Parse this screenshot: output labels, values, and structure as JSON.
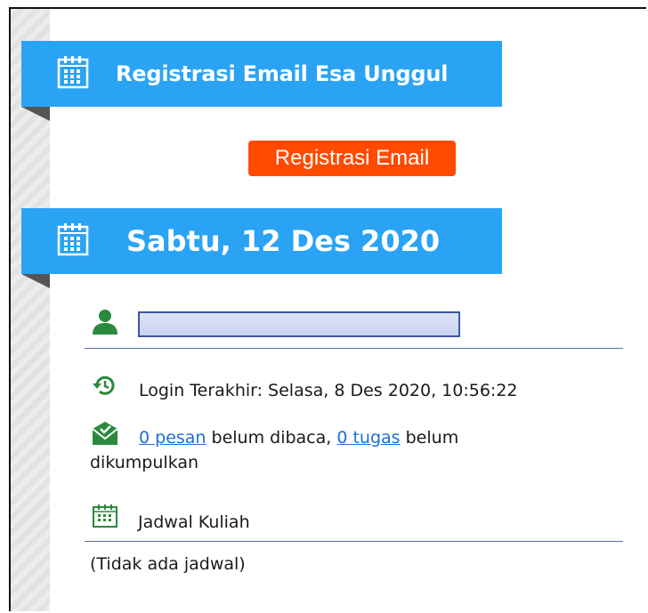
{
  "banner1": {
    "title": "Registrasi Email Esa Unggul",
    "button_label": "Registrasi Email"
  },
  "banner2": {
    "date": "Sabtu, 12 Des 2020"
  },
  "user": {
    "name_value": ""
  },
  "login": {
    "text": "Login Terakhir: Selasa, 8 Des 2020, 10:56:22"
  },
  "messages": {
    "pesan_link": "0 pesan",
    "middle_text": " belum dibaca, ",
    "tugas_link": "0 tugas",
    "tail_text": " belum",
    "line2": "dikumpulkan"
  },
  "schedule": {
    "title": "Jadwal Kuliah",
    "empty": "(Tidak ada jadwal)"
  },
  "colors": {
    "banner": "#2aa3f5",
    "button": "#ff4a00",
    "icon_green": "#2a8a3c",
    "link": "#1f6fd1"
  },
  "icons": [
    "calendar-icon",
    "user-icon",
    "history-icon",
    "envelope-icon",
    "calendar-small-icon"
  ]
}
